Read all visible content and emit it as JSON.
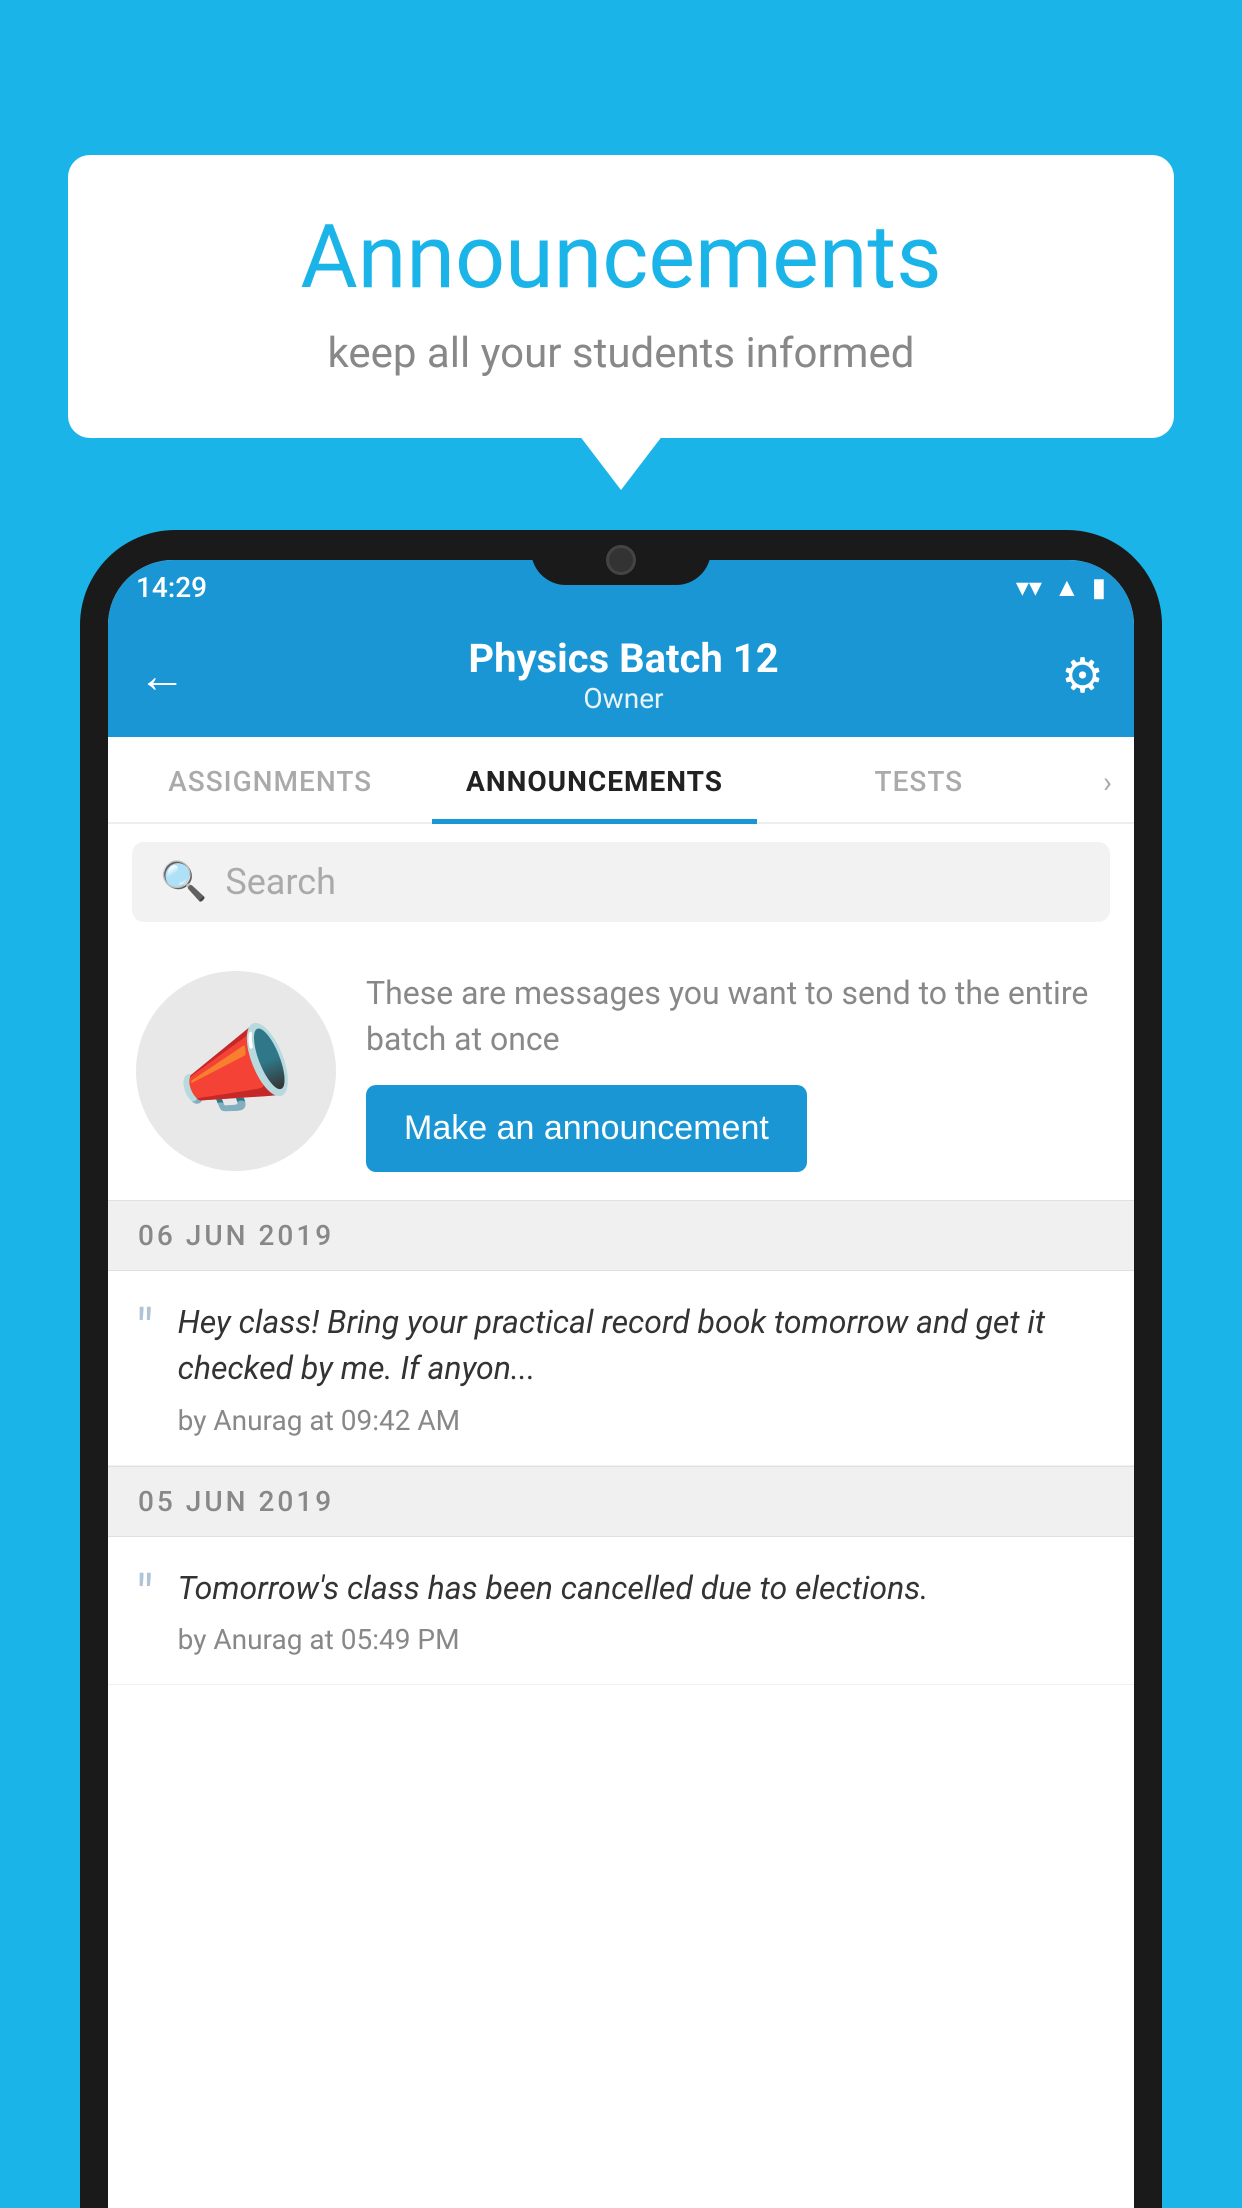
{
  "background_color": "#1ab4e8",
  "speech_bubble": {
    "title": "Announcements",
    "subtitle": "keep all your students informed"
  },
  "phone": {
    "status_bar": {
      "time": "14:29",
      "icons": [
        "wifi",
        "signal",
        "battery"
      ]
    },
    "header": {
      "title": "Physics Batch 12",
      "subtitle": "Owner",
      "back_label": "←",
      "gear_label": "⚙"
    },
    "tabs": [
      {
        "label": "ASSIGNMENTS",
        "active": false
      },
      {
        "label": "ANNOUNCEMENTS",
        "active": true
      },
      {
        "label": "TESTS",
        "active": false
      }
    ],
    "search": {
      "placeholder": "Search"
    },
    "cta": {
      "description": "These are messages you want to send to the entire batch at once",
      "button_label": "Make an announcement"
    },
    "announcements": [
      {
        "date": "06  JUN  2019",
        "message": "Hey class! Bring your practical record book tomorrow and get it checked by me. If anyon...",
        "by": "by Anurag at 09:42 AM"
      },
      {
        "date": "05  JUN  2019",
        "message": "Tomorrow's class has been cancelled due to elections.",
        "by": "by Anurag at 05:49 PM"
      }
    ]
  }
}
